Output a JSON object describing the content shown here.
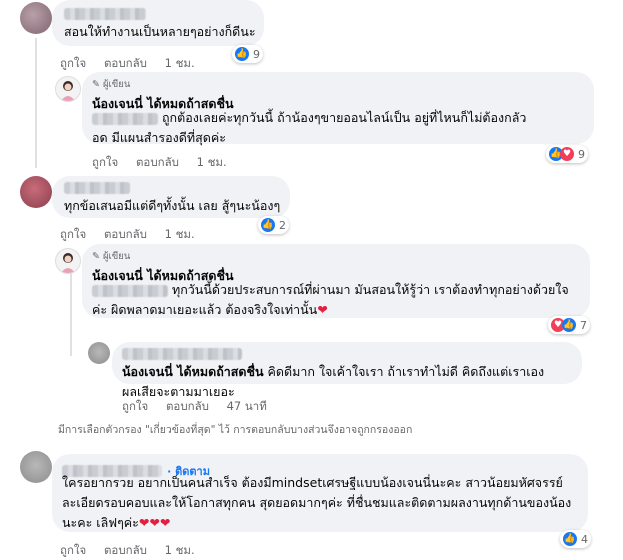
{
  "comments": [
    {
      "text": "สอนให้ทำงานเป็นหลายๆอย่างก็ดีนะ",
      "actions": [
        "ถูกใจ",
        "ตอบกลับ",
        "1 ชม."
      ],
      "reaction_count": "9"
    },
    {
      "author_badge": "ผู้เขียน",
      "name": "น้องเจนนี่ ได้หมดถ้าสดชื่น",
      "text_line1": "ถูกต้องเลยค่ะทุกวันนี้ ถ้าน้องๆขายออนไลน์เป็น อยู่ที่ไหนก็ไม่ต้องกลัว",
      "text_line2": "อด มีแผนสำรองดีที่สุดค่ะ",
      "actions": [
        "ถูกใจ",
        "ตอบกลับ",
        "1 ชม."
      ],
      "reaction_count": "9"
    },
    {
      "text": "ทุกข้อเสนอมีแต่ดีๆทั้งนั้น เลย สู้ๆนะน้องๆ",
      "actions": [
        "ถูกใจ",
        "ตอบกลับ",
        "1 ชม."
      ],
      "reaction_count": "2"
    },
    {
      "author_badge": "ผู้เขียน",
      "name": "น้องเจนนี่ ได้หมดถ้าสดชื่น",
      "text_line1": "ทุกวันนี้ด้วยประสบการณ์ที่ผ่านมา มันสอนให้รู้ว่า เราต้องทำทุกอย่างด้วยใจ",
      "text_line2": "ค่ะ ผิดพลาดมาเยอะแล้ว ต้องจริงใจเท่านั้น",
      "text_emoji": "❤",
      "actions": [
        "ถูกใจ",
        "ตอบกลับ",
        "1 ชม."
      ],
      "reaction_count": "7"
    },
    {
      "mention": "น้องเจนนี่ ได้หมดถ้าสดชื่น",
      "text_line1": "คิดดีมาก ใจเค้าใจเรา ถ้าเราทำไม่ดี คิดถึงแต่เราเอง",
      "text_line2": "ผลเสียจะตามมาเยอะ",
      "actions": [
        "ถูกใจ",
        "ตอบกลับ",
        "47 นาที"
      ]
    },
    {
      "follow": "· ติดตาม",
      "text_line1": "ใครอยากรวย อยากเป็นคนสำเร็จ ต้องมีmindsetเศรษฐีแบบน้องเจนนี่นะคะ สาวน้อยมหัศจรรย์",
      "text_line2": "ละเอียดรอบคอบและให้โอกาสทุกคน สุดยอดมากๆค่ะ ที่ชื่นชมและติดตามผลงานทุกด้านของน้อง",
      "text_line3": "นะคะ เลิฟๆค่ะ",
      "text_emoji": "❤❤❤",
      "actions": [
        "ถูกใจ",
        "ตอบกลับ",
        "1 ชม."
      ],
      "reaction_count": "4"
    }
  ],
  "filter_note": "มีการเลือกตัวกรอง \"เกี่ยวข้องที่สุด\" ไว้ การตอบกลับบางส่วนจึงอาจถูกกรองออก",
  "colors": {
    "bubble": "#f0f2f5",
    "like": "#1877f2",
    "love": "#f33e58",
    "meta": "#65676b"
  }
}
